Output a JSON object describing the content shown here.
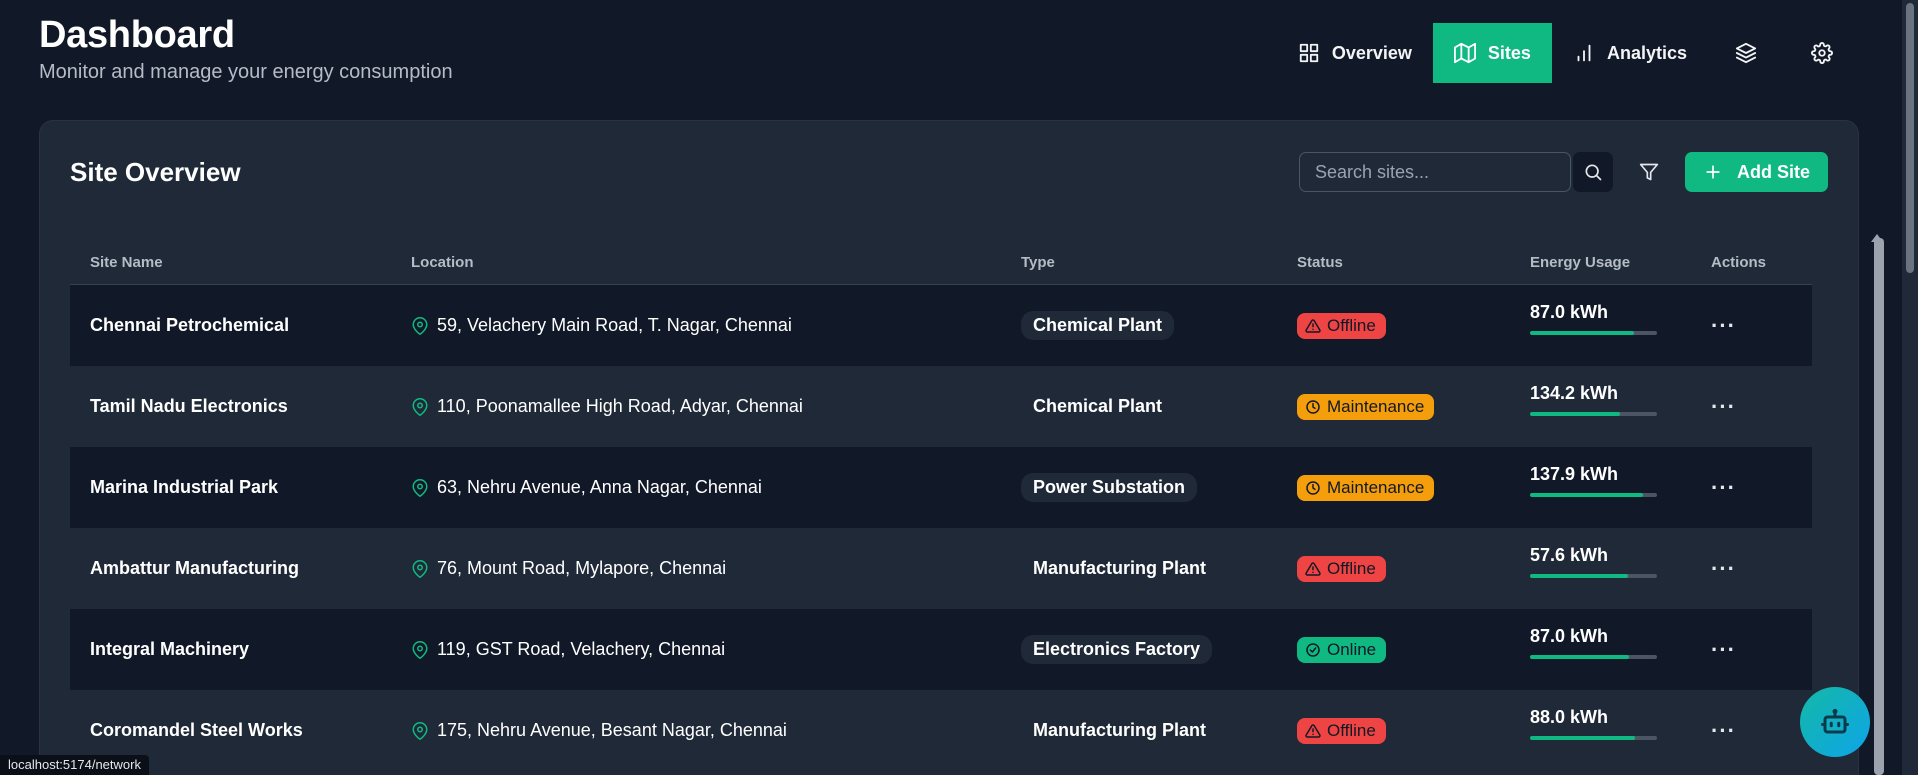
{
  "header": {
    "title": "Dashboard",
    "subtitle": "Monitor and manage your energy consumption"
  },
  "nav": {
    "overview": "Overview",
    "sites": "Sites",
    "analytics": "Analytics",
    "active": "Sites"
  },
  "card": {
    "title": "Site Overview",
    "search_placeholder": "Search sites...",
    "add_label": "Add Site"
  },
  "table": {
    "columns": [
      "Site Name",
      "Location",
      "Type",
      "Status",
      "Energy Usage",
      "Actions"
    ],
    "rows": [
      {
        "name": "Chennai Petrochemical",
        "location": "59, Velachery Main Road, T. Nagar, Chennai",
        "type": "Chemical Plant",
        "type_pill": true,
        "status": "Offline",
        "energy": "87.0 kWh",
        "energy_fraction": 0.82
      },
      {
        "name": "Tamil Nadu Electronics",
        "location": "110, Poonamallee High Road, Adyar, Chennai",
        "type": "Chemical Plant",
        "type_pill": false,
        "status": "Maintenance",
        "energy": "134.2 kWh",
        "energy_fraction": 0.71
      },
      {
        "name": "Marina Industrial Park",
        "location": "63, Nehru Avenue, Anna Nagar, Chennai",
        "type": "Power Substation",
        "type_pill": true,
        "status": "Maintenance",
        "energy": "137.9 kWh",
        "energy_fraction": 0.89
      },
      {
        "name": "Ambattur Manufacturing",
        "location": "76, Mount Road, Mylapore, Chennai",
        "type": "Manufacturing Plant",
        "type_pill": false,
        "status": "Offline",
        "energy": "57.6 kWh",
        "energy_fraction": 0.77
      },
      {
        "name": "Integral Machinery",
        "location": "119, GST Road, Velachery, Chennai",
        "type": "Electronics Factory",
        "type_pill": true,
        "status": "Online",
        "energy": "87.0 kWh",
        "energy_fraction": 0.78
      },
      {
        "name": "Coromandel Steel Works",
        "location": "175, Nehru Avenue, Besant Nagar, Chennai",
        "type": "Manufacturing Plant",
        "type_pill": false,
        "status": "Offline",
        "energy": "88.0 kWh",
        "energy_fraction": 0.83
      }
    ]
  },
  "status_colors": {
    "Offline": "#ef4444",
    "Maintenance": "#f59e0b",
    "Online": "#10b981"
  },
  "status_icons": {
    "Offline": "alert-triangle-icon",
    "Maintenance": "clock-icon",
    "Online": "check-circle-icon"
  },
  "accent_color": "#10b981",
  "browser_status": "localhost:5174/network"
}
